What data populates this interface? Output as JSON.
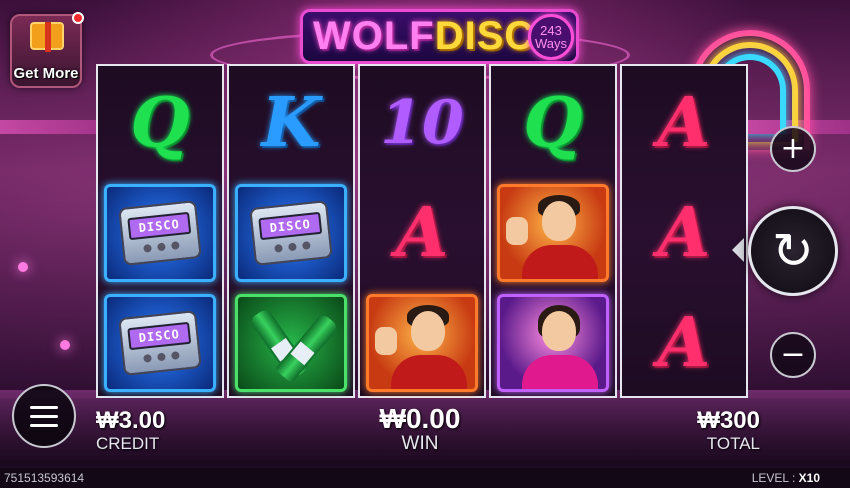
{
  "promo": {
    "label": "Get More"
  },
  "logo": {
    "title_part1": "WOLF",
    "title_part2": "DISCO",
    "ways_number": "243",
    "ways_label": "Ways"
  },
  "reels": [
    {
      "symbols": [
        "Q",
        "pager",
        "pager"
      ],
      "letters": [
        "Q"
      ]
    },
    {
      "symbols": [
        "K",
        "pager",
        "bottles"
      ],
      "letters": [
        "K"
      ]
    },
    {
      "symbols": [
        "10",
        "A",
        "man-portrait"
      ],
      "letters": [
        "10",
        "A"
      ]
    },
    {
      "symbols": [
        "Q",
        "man-portrait",
        "woman-portrait"
      ],
      "letters": [
        "Q"
      ]
    },
    {
      "symbols": [
        "A",
        "A",
        "A"
      ],
      "letters": [
        "A",
        "A",
        "A"
      ]
    }
  ],
  "pager_screen_text": "DISCO",
  "controls": {
    "plus_label": "+",
    "minus_label": "−",
    "spin_label": "↻"
  },
  "stats": {
    "credit_value": "₩3.00",
    "credit_label": "CREDIT",
    "win_value": "₩0.00",
    "win_label": "WIN",
    "total_value": "₩300",
    "total_label": "TOTAL"
  },
  "footer": {
    "round_id": "751513593614",
    "level_label": "LEVEL :",
    "level_value": "X10"
  },
  "colors": {
    "q": "#1fe04f",
    "k": "#2a9cff",
    "ten": "#b05cff",
    "a": "#ff2f6e",
    "logo_pink": "#ff7ff0",
    "logo_gold": "#ffd93a"
  }
}
